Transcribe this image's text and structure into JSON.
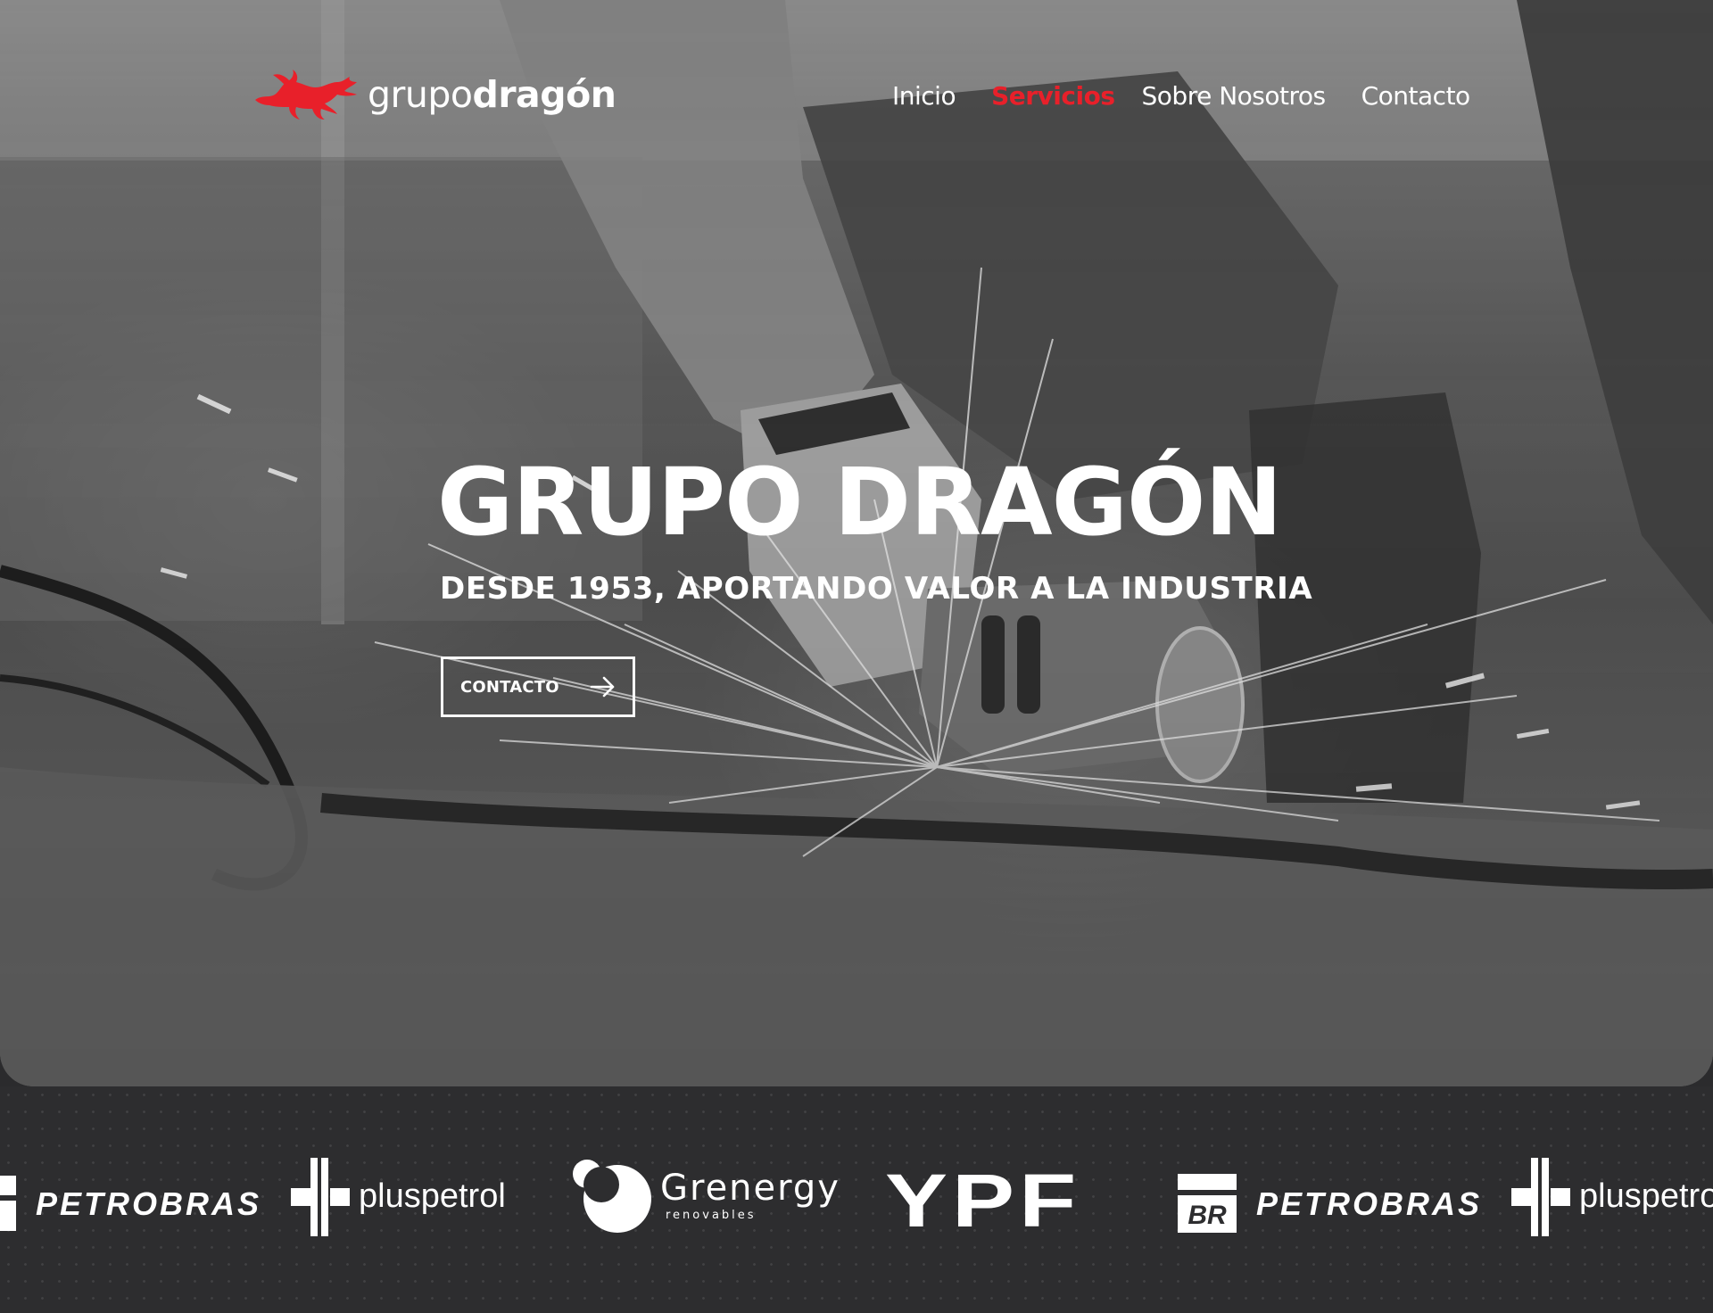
{
  "header": {
    "logo": {
      "text_light": "grupo",
      "text_bold": "dragón",
      "icon": "dragon-icon"
    },
    "nav": [
      {
        "label": "Inicio",
        "active": false
      },
      {
        "label": "Servicios",
        "active": true
      },
      {
        "label": "Sobre Nosotros",
        "active": false
      },
      {
        "label": "Contacto",
        "active": false
      }
    ]
  },
  "hero": {
    "title": "GRUPO DRAGÓN",
    "subtitle": "DESDE 1953, APORTANDO VALOR A LA INDUSTRIA",
    "cta": {
      "label": "CONTACTO",
      "icon": "arrow-right-icon"
    }
  },
  "clients": {
    "logos": [
      {
        "name": "PETROBRAS",
        "badge": "BR"
      },
      {
        "name": "pluspetrol"
      },
      {
        "name": "Grenergy",
        "sub": "renovables"
      },
      {
        "name": "YPF"
      },
      {
        "name": "PETROBRAS",
        "badge": "BR"
      },
      {
        "name": "pluspetrol"
      }
    ]
  },
  "colors": {
    "accent": "#e8202a",
    "text": "#ffffff",
    "strip_background": "#2d2d2f"
  }
}
